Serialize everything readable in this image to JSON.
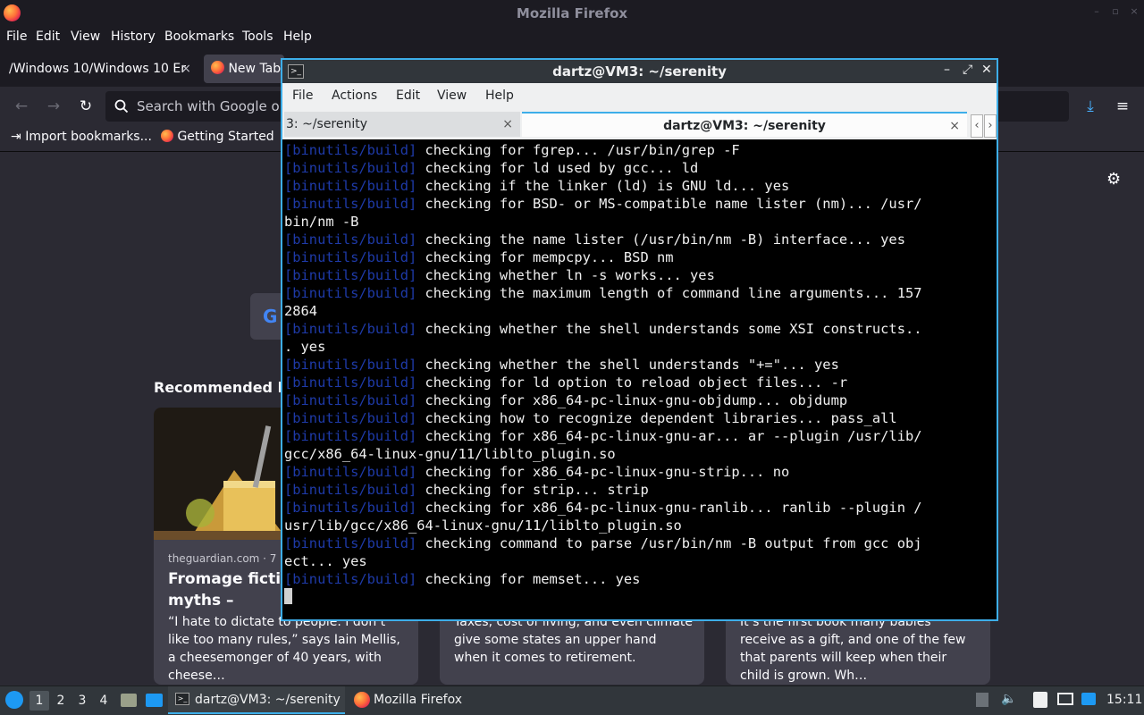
{
  "firefox": {
    "window_title": "Mozilla Firefox",
    "menu": [
      "File",
      "Edit",
      "View",
      "History",
      "Bookmarks",
      "Tools",
      "Help"
    ],
    "tabs": [
      {
        "label": "/Windows 10/Windows 10 Er"
      },
      {
        "label": "New Tab"
      }
    ],
    "tab_close": "×",
    "url_placeholder": "Search with Google or",
    "bookmarks": [
      "Import bookmarks...",
      "Getting Started"
    ],
    "recommended_heading": "Recommended by",
    "cards": [
      {
        "source": "theguardian.com · 7 m",
        "headline": "Fromage fiction cheese myths –",
        "excerpt": "“I hate to dictate to people. I don’t like too many rules,” says Iain Mellis, a cheesemonger of 40 years, with cheese…"
      },
      {
        "excerpt": "Taxes, cost of living, and even climate give some states an upper hand when it comes to retirement."
      },
      {
        "excerpt": "It’s the first book many babies receive as a gift, and one of the few that parents will keep when their child is grown. Wh…"
      }
    ]
  },
  "terminal": {
    "title": "dartz@VM3: ~/serenity",
    "menu": [
      "File",
      "Actions",
      "Edit",
      "View",
      "Help"
    ],
    "tabs": [
      {
        "label": "3: ~/serenity"
      },
      {
        "label": "dartz@VM3: ~/serenity"
      }
    ],
    "prefix": "[binutils/build]",
    "lines": [
      {
        "p": true,
        "t": " checking for fgrep... /usr/bin/grep -F"
      },
      {
        "p": true,
        "t": " checking for ld used by gcc... ld"
      },
      {
        "p": true,
        "t": " checking if the linker (ld) is GNU ld... yes"
      },
      {
        "p": true,
        "t": " checking for BSD- or MS-compatible name lister (nm)... /usr/"
      },
      {
        "p": false,
        "t": "bin/nm -B"
      },
      {
        "p": true,
        "t": " checking the name lister (/usr/bin/nm -B) interface... yes"
      },
      {
        "p": true,
        "t": " checking for mempcpy... BSD nm"
      },
      {
        "p": true,
        "t": " checking whether ln -s works... yes"
      },
      {
        "p": true,
        "t": " checking the maximum length of command line arguments... 157"
      },
      {
        "p": false,
        "t": "2864"
      },
      {
        "p": true,
        "t": " checking whether the shell understands some XSI constructs.."
      },
      {
        "p": false,
        "t": ". yes"
      },
      {
        "p": true,
        "t": " checking whether the shell understands \"+=\"... yes"
      },
      {
        "p": true,
        "t": " checking for ld option to reload object files... -r"
      },
      {
        "p": true,
        "t": " checking for x86_64-pc-linux-gnu-objdump... objdump"
      },
      {
        "p": true,
        "t": " checking how to recognize dependent libraries... pass_all"
      },
      {
        "p": true,
        "t": " checking for x86_64-pc-linux-gnu-ar... ar --plugin /usr/lib/"
      },
      {
        "p": false,
        "t": "gcc/x86_64-linux-gnu/11/liblto_plugin.so"
      },
      {
        "p": true,
        "t": " checking for x86_64-pc-linux-gnu-strip... no"
      },
      {
        "p": true,
        "t": " checking for strip... strip"
      },
      {
        "p": true,
        "t": " checking for x86_64-pc-linux-gnu-ranlib... ranlib --plugin /"
      },
      {
        "p": false,
        "t": "usr/lib/gcc/x86_64-linux-gnu/11/liblto_plugin.so"
      },
      {
        "p": true,
        "t": " checking command to parse /usr/bin/nm -B output from gcc obj"
      },
      {
        "p": false,
        "t": "ect... yes"
      },
      {
        "p": true,
        "t": " checking for memset... yes"
      }
    ]
  },
  "taskbar": {
    "desktops": [
      "1",
      "2",
      "3",
      "4"
    ],
    "tasks": [
      {
        "label": "dartz@VM3: ~/serenity"
      },
      {
        "label": "Mozilla Firefox"
      }
    ],
    "clock": "15:11"
  },
  "colors": {
    "terminal_prefix": "#1e3aa8",
    "active_border": "#3daee9"
  }
}
